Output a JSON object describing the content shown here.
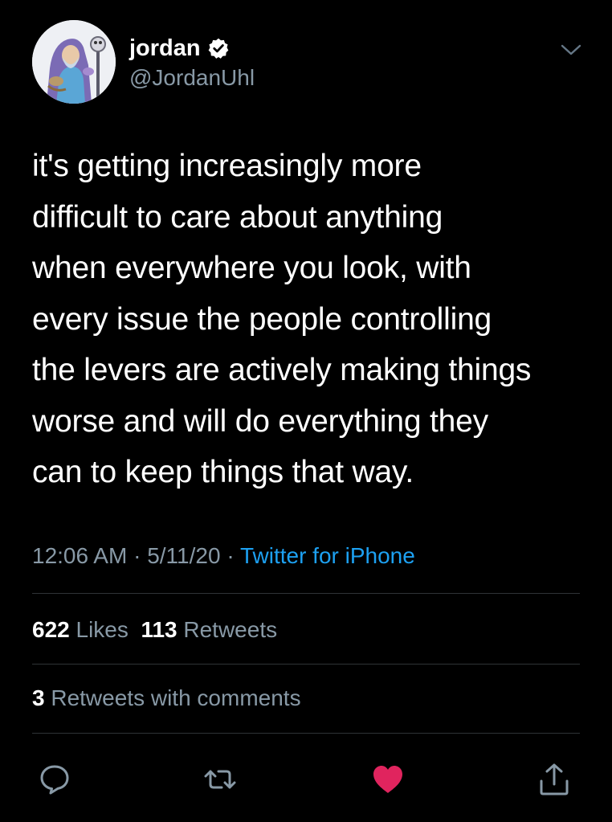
{
  "colors": {
    "background": "#000000",
    "text_primary": "#ffffff",
    "text_secondary": "#8899a6",
    "link": "#1da1f2",
    "like": "#e0245e",
    "divider": "#2f3336"
  },
  "author": {
    "display_name": "jordan",
    "handle": "@JordanUhl",
    "verified": true,
    "avatar_icon": "avatar-illustration"
  },
  "tweet": {
    "lines": [
      "it's getting increasingly more",
      "difficult to care about anything",
      "when everywhere you look, with",
      "every issue the people controlling",
      "the levers are actively making things",
      "worse and will do everything they",
      "can to keep things that way."
    ]
  },
  "meta": {
    "time": "12:06 AM",
    "sep1": " · ",
    "date": "5/11/20",
    "sep2": " · ",
    "source": "Twitter for iPhone"
  },
  "stats": {
    "likes_count": "622",
    "likes_label": "Likes",
    "retweets_count": "113",
    "retweets_label": "Retweets"
  },
  "retweets_with_comments": {
    "count": "3",
    "label": "Retweets with comments"
  },
  "actions": [
    {
      "icon": "reply-icon"
    },
    {
      "icon": "retweet-icon"
    },
    {
      "icon": "like-icon",
      "active": true
    },
    {
      "icon": "share-icon"
    }
  ]
}
